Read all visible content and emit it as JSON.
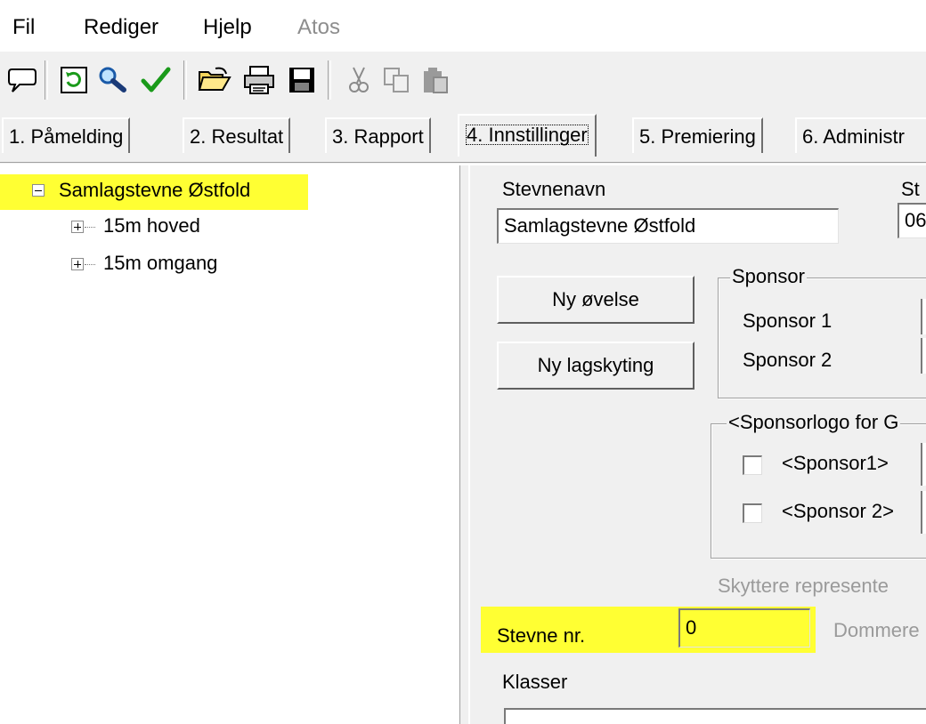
{
  "menu": {
    "items": [
      {
        "label": "Fil",
        "disabled": false
      },
      {
        "label": "Rediger",
        "disabled": false
      },
      {
        "label": "Hjelp",
        "disabled": false
      },
      {
        "label": "Atos",
        "disabled": true
      }
    ]
  },
  "toolbar": {
    "icons": [
      "speech-bubble-icon",
      "refresh-icon",
      "search-icon",
      "checkmark-icon",
      "open-folder-icon",
      "print-icon",
      "save-icon",
      "cut-icon",
      "copy-icon",
      "paste-icon"
    ]
  },
  "tabs": [
    {
      "label": "1. Påmelding"
    },
    {
      "label": "2. Resultat"
    },
    {
      "label": "3. Rapport"
    },
    {
      "label": "4. Innstillinger",
      "active": true
    },
    {
      "label": "5. Premiering"
    },
    {
      "label": "6. Administr"
    }
  ],
  "tree": {
    "root": "Samlagstevne Østfold",
    "children": [
      "15m hoved",
      "15m omgang"
    ]
  },
  "settings": {
    "stevnenavn_label": "Stevnenavn",
    "stevnenavn_value": "Samlagstevne Østfold",
    "st_label": "St",
    "st_value": "06",
    "ny_ovelse_button": "Ny øvelse",
    "ny_lagskyting_button": "Ny lagskyting",
    "sponsor_group_title": "Sponsor",
    "sponsor1_label": "Sponsor 1",
    "sponsor2_label": "Sponsor 2",
    "sponsorlogo_group_title": "<Sponsorlogo for G",
    "logo_sponsor1_label": "<Sponsor1>",
    "logo_sponsor2_label": "<Sponsor 2>",
    "skyttere_label": "Skyttere represente",
    "stevne_nr_label": "Stevne nr.",
    "stevne_nr_value": "0",
    "dommere_label": "Dommere",
    "klasser_label": "Klasser"
  },
  "colors": {
    "highlight": "#ffff33",
    "window_bg": "#f0f0f0",
    "check_green": "#1a9a1a"
  }
}
